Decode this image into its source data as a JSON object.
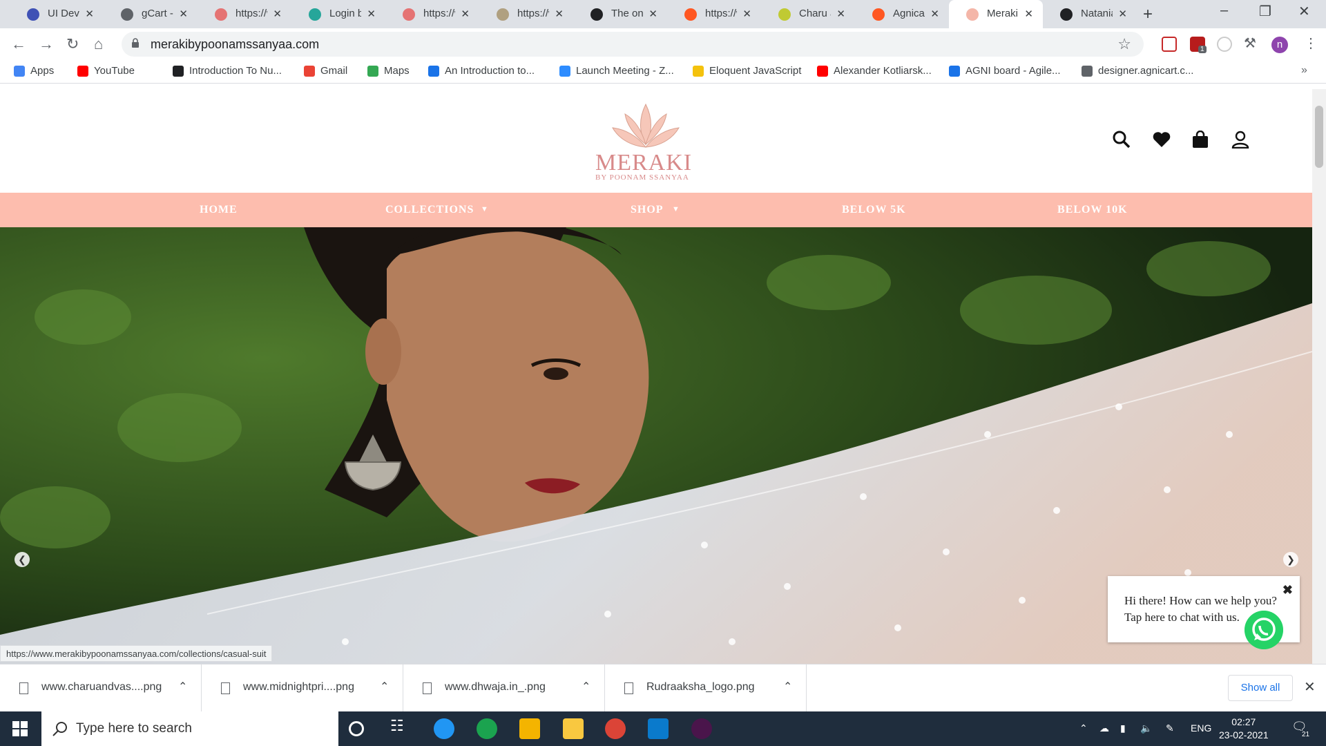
{
  "browser": {
    "tabs": [
      {
        "title": "UI Devel",
        "color": "#3f51b5"
      },
      {
        "title": "gCart - A",
        "color": "#5f6368"
      },
      {
        "title": "https://w",
        "color": "#e57373"
      },
      {
        "title": "Login by",
        "color": "#26a69a"
      },
      {
        "title": "https://w",
        "color": "#e57373"
      },
      {
        "title": "https://w",
        "color": "#b0a080"
      },
      {
        "title": "The onli",
        "color": "#202124"
      },
      {
        "title": "https://w",
        "color": "#ff5722"
      },
      {
        "title": "Charu ar",
        "color": "#c0ca33"
      },
      {
        "title": "Agnicart",
        "color": "#ff5722"
      },
      {
        "title": "Meraki E",
        "color": "#f4b6a8"
      },
      {
        "title": "Natania",
        "color": "#202124"
      }
    ],
    "active_tab": 10,
    "url": "merakibypoonamssanyaa.com",
    "bookmarks": [
      {
        "label": "Apps",
        "color": "#4285f4"
      },
      {
        "label": "YouTube",
        "color": "#ff0000"
      },
      {
        "label": "Introduction To Nu...",
        "color": "#202124"
      },
      {
        "label": "Gmail",
        "color": "#ea4335"
      },
      {
        "label": "Maps",
        "color": "#34a853"
      },
      {
        "label": "An Introduction to...",
        "color": "#1a73e8"
      },
      {
        "label": "Launch Meeting - Z...",
        "color": "#2d8cff"
      },
      {
        "label": "Eloquent JavaScript",
        "color": "#f4c20d"
      },
      {
        "label": "Alexander Kotliarsk...",
        "color": "#ff0000"
      },
      {
        "label": "AGNI board - Agile...",
        "color": "#1a73e8"
      },
      {
        "label": "designer.agnicart.c...",
        "color": "#5f6368"
      }
    ],
    "profile_initial": "n",
    "extension_badge": "1"
  },
  "site": {
    "logo_text": "MERAKI",
    "logo_sub": "BY POONAM SSANYAA",
    "brand_color": "#fdbdae",
    "nav": [
      "HOME",
      "COLLECTIONS",
      "SHOP",
      "BELOW 5K",
      "BELOW 10K"
    ],
    "status_url": "https://www.merakibypoonamssanyaa.com/collections/casual-suit",
    "chat": {
      "line1": "Hi there! How can we help you?",
      "line2": "Tap here to chat with us."
    }
  },
  "downloads": {
    "items": [
      "www.charuandvas....png",
      "www.midnightpri....png",
      "www.dhwaja.in_.png",
      "Rudraaksha_logo.png"
    ],
    "show_all": "Show all"
  },
  "taskbar": {
    "search_placeholder": "Type here to search",
    "language": "ENG",
    "time": "02:27",
    "date": "23-02-2021",
    "notifications": "21"
  }
}
